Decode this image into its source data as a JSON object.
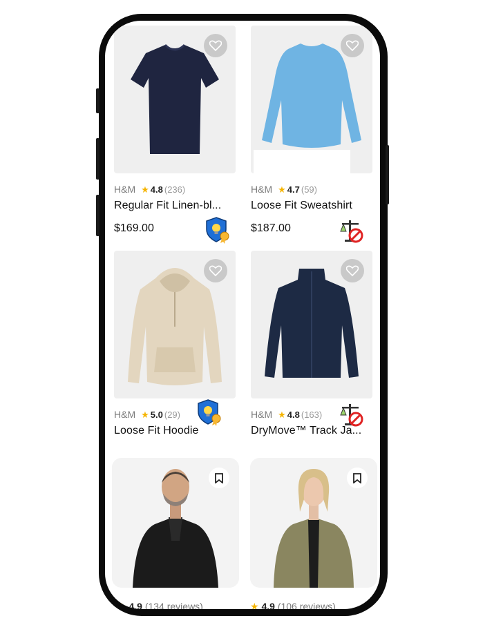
{
  "products": [
    {
      "brand": "H&M",
      "rating": "4.8",
      "count": "(236)",
      "title": "Regular Fit Linen-bl...",
      "price": "$169.00",
      "badge": "shield-bulb-award-icon"
    },
    {
      "brand": "H&M",
      "rating": "4.7",
      "count": "(59)",
      "title": "Loose Fit Sweatshirt",
      "price": "$187.00",
      "badge": "scale-ban-icon"
    },
    {
      "brand": "H&M",
      "rating": "5.0",
      "count": "(29)",
      "title": "Loose Fit Hoodie",
      "badge": "shield-bulb-award-icon"
    },
    {
      "brand": "H&M",
      "rating": "4.8",
      "count": "(163)",
      "title": "DryMove™ Track Ja...",
      "badge": "scale-ban-icon"
    }
  ],
  "people": [
    {
      "rating": "4.9",
      "reviews": "(134 reviews)"
    },
    {
      "rating": "4.9",
      "reviews": "(106 reviews)"
    }
  ],
  "colors": {
    "tshirt": "#1f2540",
    "sweatshirt": "#6fb4e3",
    "hoodie": "#e3d6bf",
    "jacket": "#1d2a44",
    "leather": "#1b1b1b",
    "olive": "#8a8660"
  }
}
